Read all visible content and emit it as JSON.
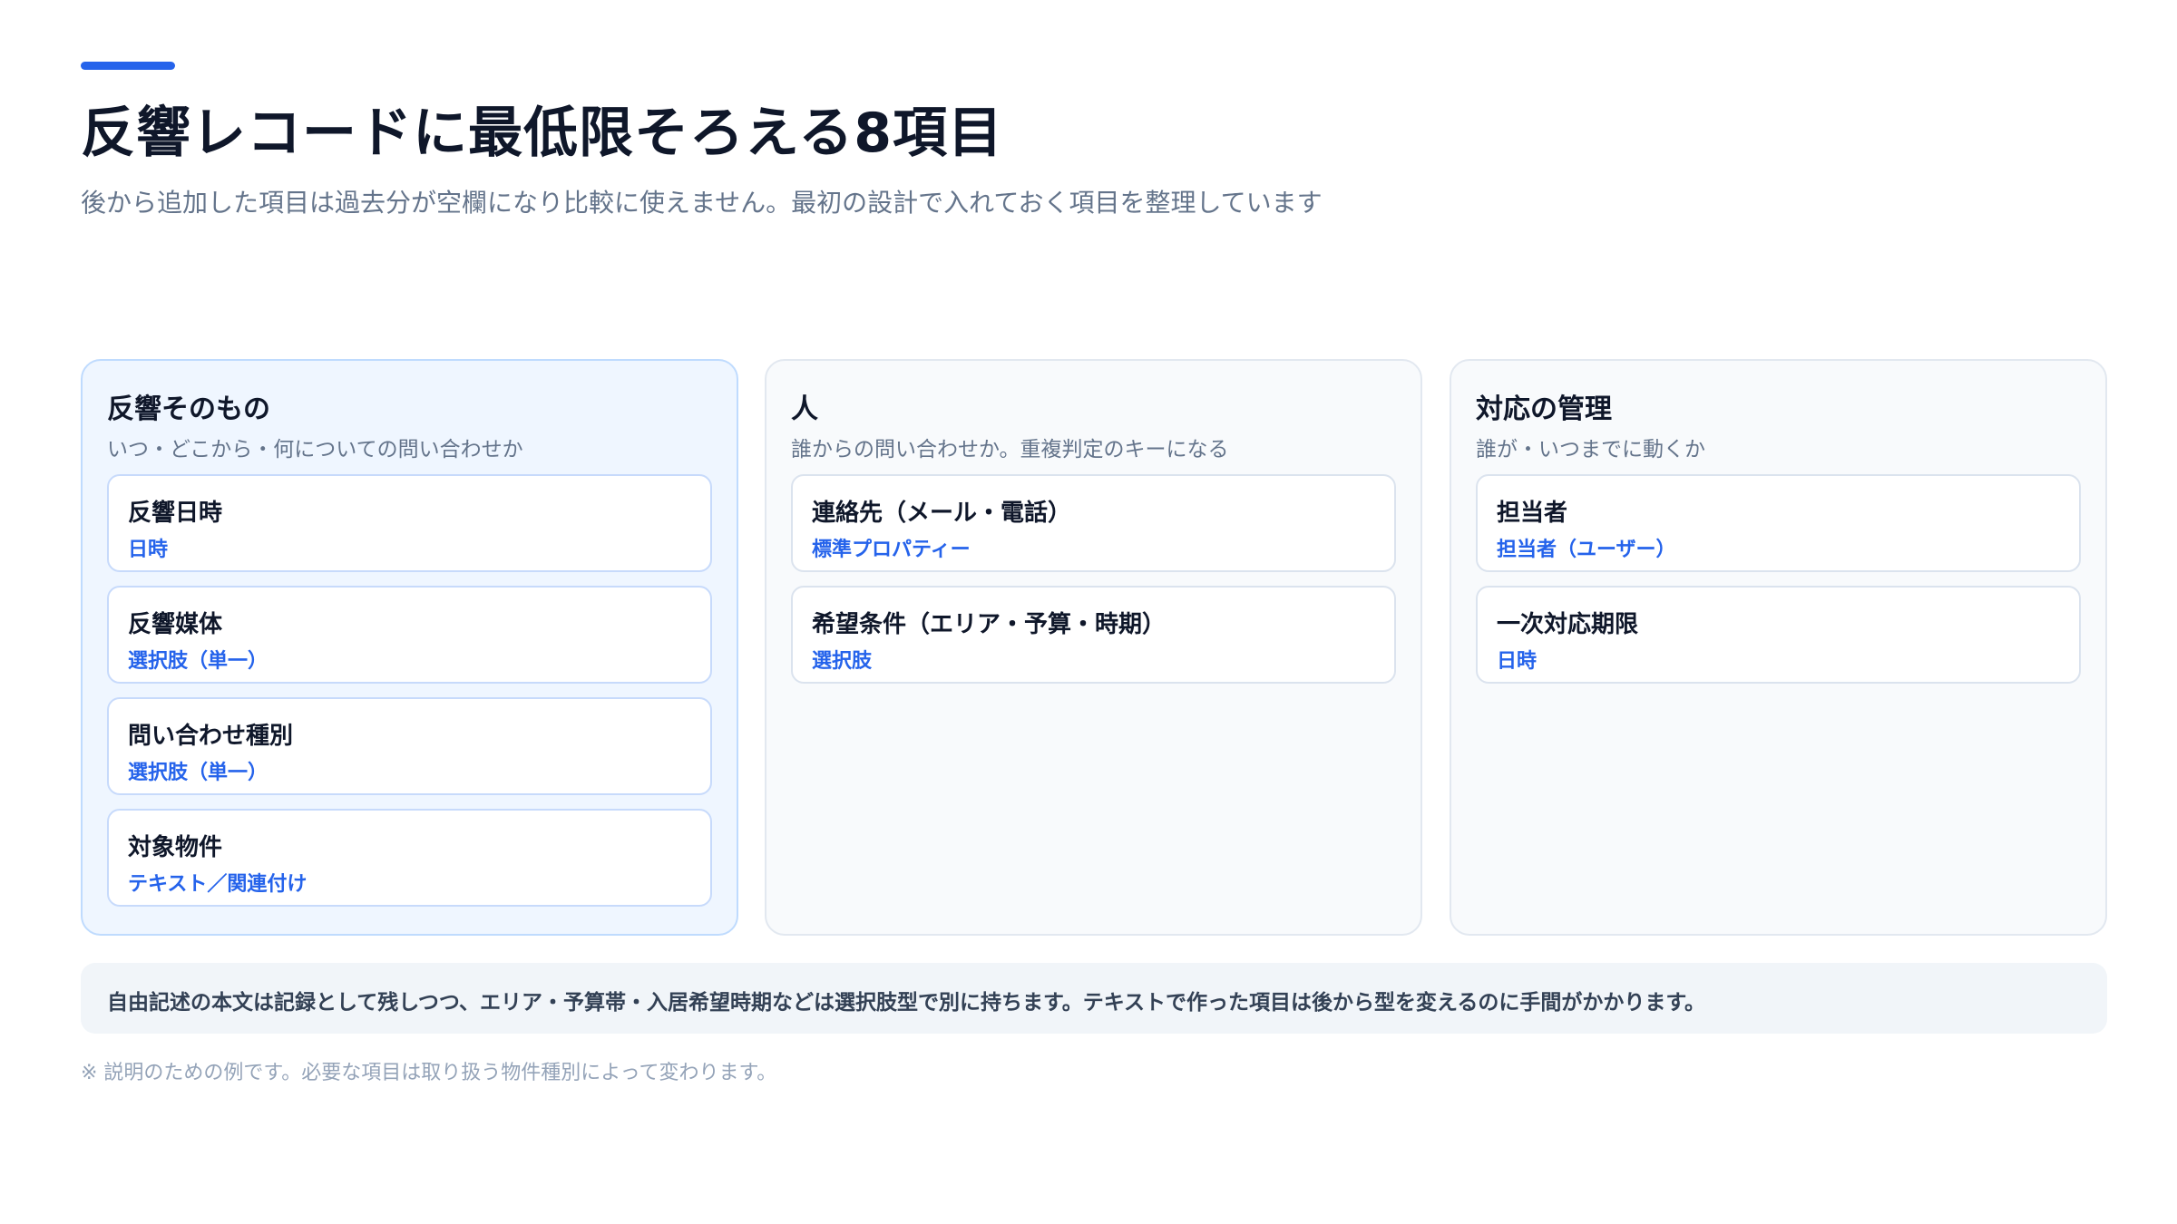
{
  "header": {
    "title": "反響レコードに最低限そろえる8項目",
    "subtitle": "後から追加した項目は過去分が空欄になり比較に使えません。最初の設計で入れておく項目を整理しています"
  },
  "columns": [
    {
      "title": "反響そのもの",
      "description": "いつ・どこから・何についての問い合わせか",
      "items": [
        {
          "name": "反響日時",
          "type": "日時"
        },
        {
          "name": "反響媒体",
          "type": "選択肢（単一）"
        },
        {
          "name": "問い合わせ種別",
          "type": "選択肢（単一）"
        },
        {
          "name": "対象物件",
          "type": "テキスト／関連付け"
        }
      ]
    },
    {
      "title": "人",
      "description": "誰からの問い合わせか。重複判定のキーになる",
      "items": [
        {
          "name": "連絡先（メール・電話）",
          "type": "標準プロパティー"
        },
        {
          "name": "希望条件（エリア・予算・時期）",
          "type": "選択肢"
        }
      ]
    },
    {
      "title": "対応の管理",
      "description": "誰が・いつまでに動くか",
      "items": [
        {
          "name": "担当者",
          "type": "担当者（ユーザー）"
        },
        {
          "name": "一次対応期限",
          "type": "日時"
        }
      ]
    }
  ],
  "note": "自由記述の本文は記録として残しつつ、エリア・予算帯・入居希望時期などは選択肢型で別に持ちます。テキストで作った項目は後から型を変えるのに手間がかかります。",
  "footnote": "※ 説明のための例です。必要な項目は取り扱う物件種別によって変わります。",
  "colors": {
    "accent": "#2563eb",
    "title": "#0f172a",
    "muted": "#64748b",
    "highlight_card_bg": "#eff6ff",
    "card_bg": "#f8fafc"
  }
}
